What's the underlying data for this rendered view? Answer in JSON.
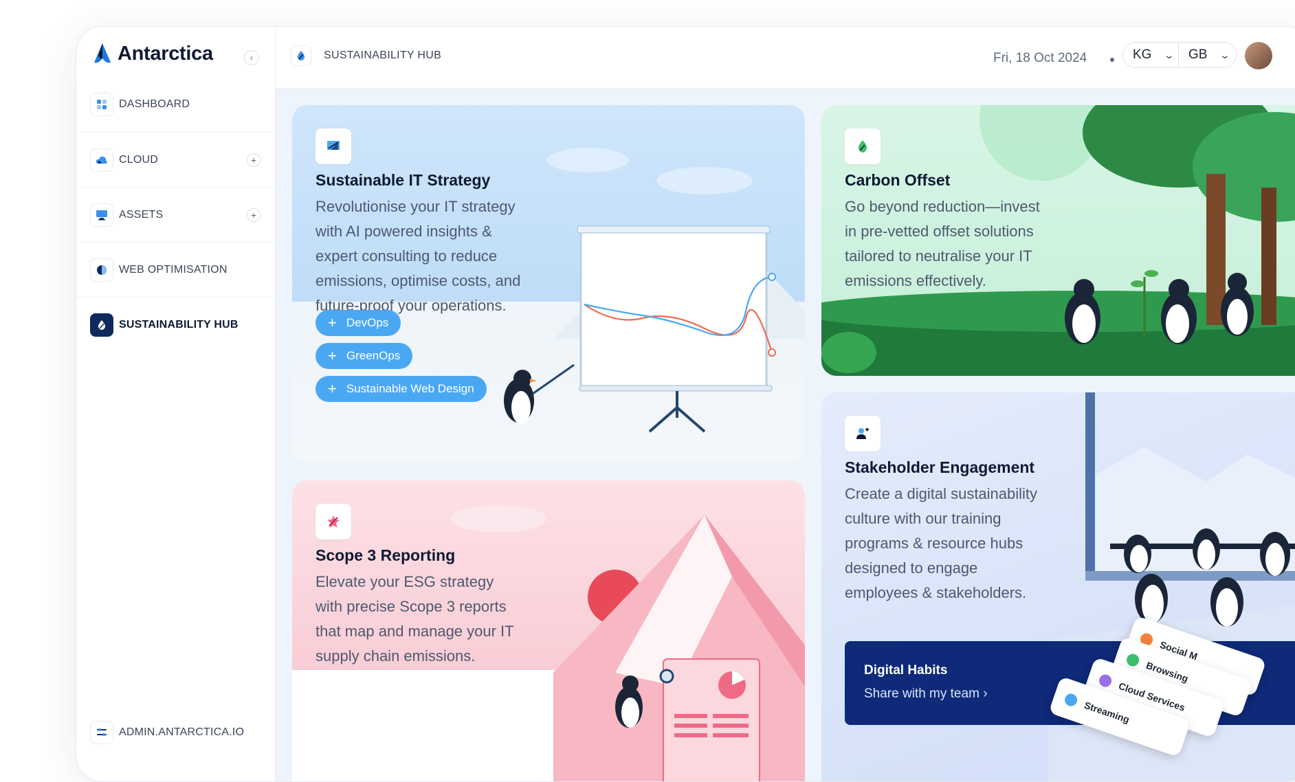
{
  "brand": {
    "name": "Antarctica"
  },
  "sidebar": {
    "items": [
      {
        "label": "DASHBOARD"
      },
      {
        "label": "CLOUD"
      },
      {
        "label": "ASSETS"
      },
      {
        "label": "WEB OPTIMISATION"
      },
      {
        "label": "SUSTAINABILITY HUB"
      }
    ],
    "footer_label": "ADMIN.ANTARCTICA.IO"
  },
  "header": {
    "title": "SUSTAINABILITY HUB",
    "date": "Fri, 18 Oct 2024",
    "unit_select": "KG",
    "region_select": "GB"
  },
  "cards": {
    "it": {
      "title": "Sustainable IT Strategy",
      "description": "Revolutionise your IT strategy with AI powered insights & expert consulting to reduce emissions, optimise costs, and future-proof your operations.",
      "tags": [
        "DevOps",
        "GreenOps",
        "Sustainable Web Design"
      ]
    },
    "carbon": {
      "title": "Carbon Offset",
      "description": "Go beyond reduction—invest in pre-vetted offset solutions tailored to neutralise your IT emissions effectively."
    },
    "scope": {
      "title": "Scope 3 Reporting",
      "description": "Elevate your ESG strategy with precise Scope 3 reports that map and manage your IT supply chain emissions."
    },
    "stake": {
      "title": "Stakeholder Engagement",
      "description": "Create a digital sustainability culture with our training programs & resource hubs designed to engage employees & stakeholders.",
      "habits": {
        "title": "Digital Habits",
        "link": "Share with my team",
        "chips": [
          "Social M",
          "Browsing",
          "Cloud Services",
          "Streaming"
        ]
      }
    }
  },
  "colors": {
    "accent": "#4aa8f3",
    "navy": "#0e2a5c",
    "habits_bg": "#0e2a78"
  }
}
